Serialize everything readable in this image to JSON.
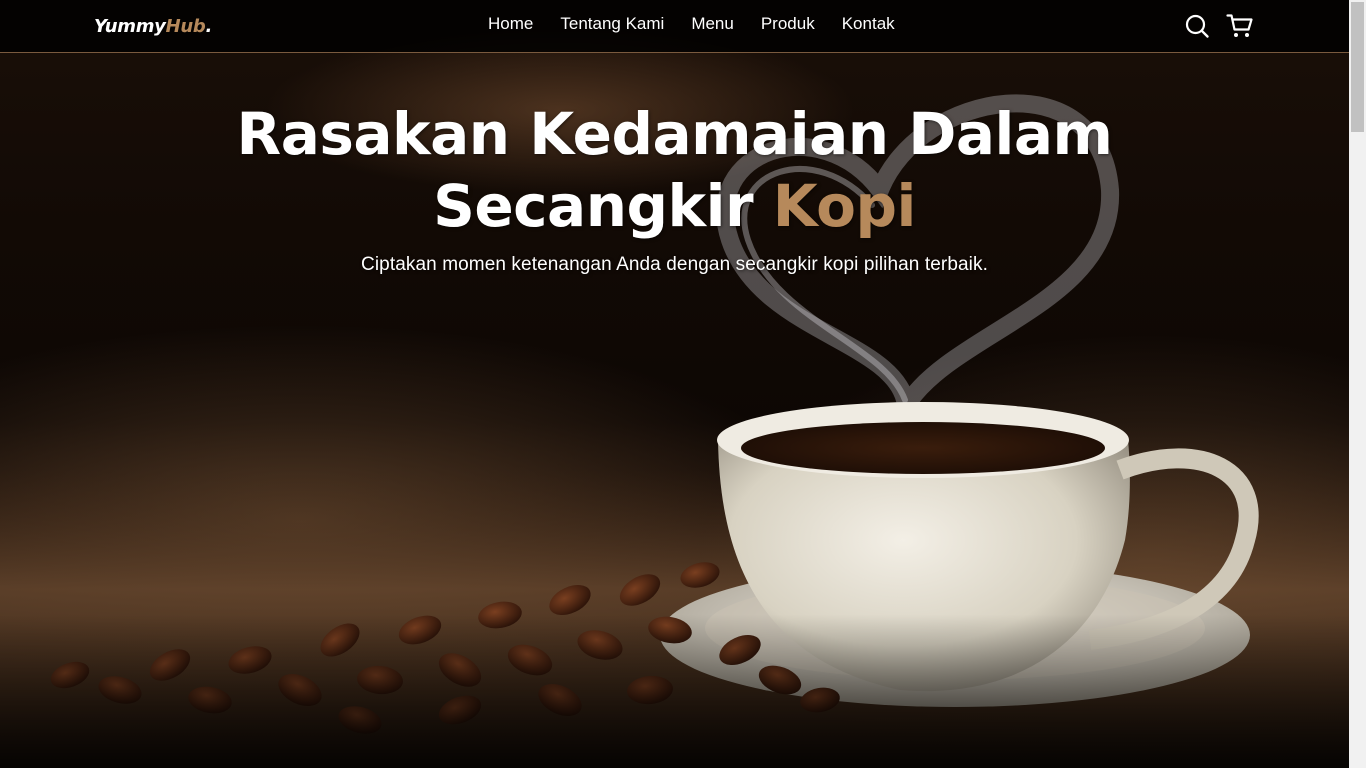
{
  "brand": {
    "name_main": "Yummy",
    "name_accent": "Hub",
    "name_dot": "."
  },
  "nav": {
    "links": [
      "Home",
      "Tentang Kami",
      "Menu",
      "Produk",
      "Kontak"
    ],
    "icons": [
      "search-icon",
      "shopping-cart-icon"
    ]
  },
  "hero": {
    "title_line1": "Rasakan Kedamaian Dalam",
    "title_line2_main": "Secangkir ",
    "title_line2_accent": "Kopi",
    "subtitle": "Ciptakan momen ketenangan Anda dengan secangkir kopi pilihan terbaik."
  },
  "colors": {
    "accent": "#b6895b",
    "navbar_bg": "#000000",
    "text": "#ffffff"
  }
}
